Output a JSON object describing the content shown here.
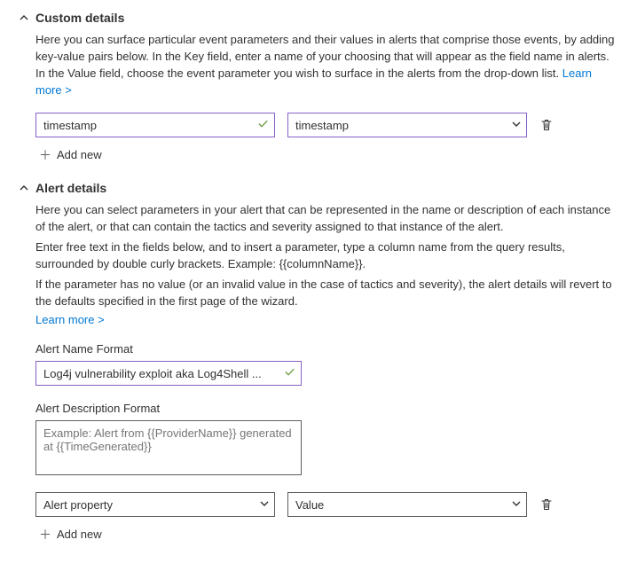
{
  "custom_details": {
    "title": "Custom details",
    "desc_text": "Here you can surface particular event parameters and their values in alerts that comprise those events, by adding key-value pairs below. In the Key field, enter a name of your choosing that will appear as the field name in alerts. In the Value field, choose the event parameter you wish to surface in the alerts from the drop-down list. ",
    "learn_more": "Learn more >",
    "key_value": "timestamp",
    "value_value": "timestamp",
    "add_new": "Add new"
  },
  "alert_details": {
    "title": "Alert details",
    "desc_line1": "Here you can select parameters in your alert that can be represented in the name or description of each instance of the alert, or that can contain the tactics and severity assigned to that instance of the alert.",
    "desc_line2": "Enter free text in the fields below, and to insert a parameter, type a column name from the query results, surrounded by double curly brackets. Example: {{columnName}}.",
    "desc_line3": "If the parameter has no value (or an invalid value in the case of tactics and severity), the alert details will revert to the defaults specified in the first page of the wizard.",
    "learn_more": "Learn more >",
    "name_format_label": "Alert Name Format",
    "name_format_value": "Log4j vulnerability exploit aka Log4Shell ...",
    "desc_format_label": "Alert Description Format",
    "desc_format_placeholder": "Example: Alert from {{ProviderName}} generated at {{TimeGenerated}}",
    "property_placeholder": "Alert property",
    "value_placeholder": "Value",
    "add_new": "Add new"
  }
}
